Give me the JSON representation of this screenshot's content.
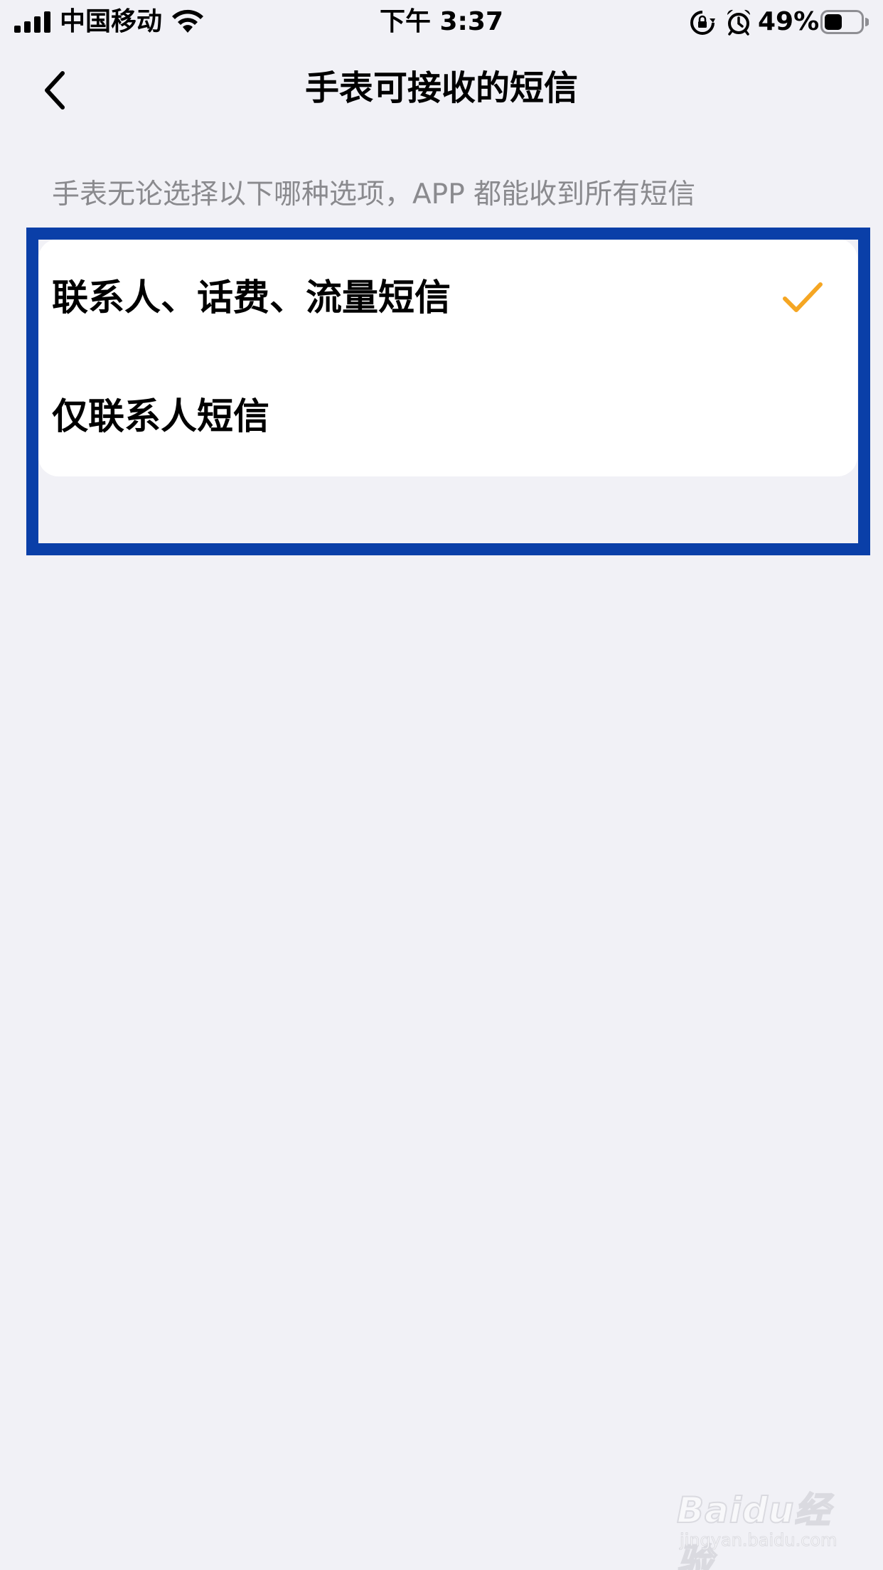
{
  "status_bar": {
    "carrier": "中国移动",
    "time": "下午 3:37",
    "battery_percent": "49%",
    "battery_level": 0.49,
    "icons": [
      "signal-icon",
      "wifi-icon",
      "rotation-lock-icon",
      "alarm-icon",
      "battery-icon"
    ]
  },
  "nav": {
    "title": "手表可接收的短信",
    "back_icon": "chevron-left-icon"
  },
  "subtitle": "手表无论选择以下哪种选项，APP 都能收到所有短信",
  "options": [
    {
      "label": "联系人、话费、流量短信",
      "selected": true
    },
    {
      "label": "仅联系人短信",
      "selected": false
    }
  ],
  "colors": {
    "accent_check": "#f5a623",
    "highlight_border": "#0a3fa8",
    "background": "#f1f1f6"
  },
  "watermark": {
    "brand": "Baidu经验",
    "url": "jingyan.baidu.com"
  }
}
